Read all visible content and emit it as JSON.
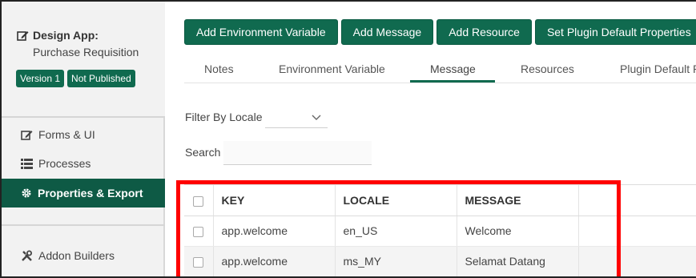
{
  "app": {
    "label": "Design App:",
    "name": "Purchase Requisition",
    "version_badge": "Version 1",
    "status_badge": "Not Published"
  },
  "sidebar": {
    "items": [
      {
        "label": "Forms & UI",
        "icon": "edit-icon"
      },
      {
        "label": "Processes",
        "icon": "list-icon"
      },
      {
        "label": "Properties & Export",
        "icon": "gear-icon",
        "active": true
      },
      {
        "label": "Addon Builders",
        "icon": "tools-icon"
      }
    ]
  },
  "toolbar": {
    "buttons": [
      "Add Environment Variable",
      "Add Message",
      "Add Resource",
      "Set Plugin Default Properties"
    ]
  },
  "tabs": [
    "Notes",
    "Environment Variable",
    "Message",
    "Resources",
    "Plugin Default P"
  ],
  "active_tab": "Message",
  "filter": {
    "label": "Filter By Locale",
    "value": ""
  },
  "search": {
    "label": "Search",
    "value": ""
  },
  "table": {
    "headers": [
      "KEY",
      "LOCALE",
      "MESSAGE"
    ],
    "rows": [
      {
        "key": "app.welcome",
        "locale": "en_US",
        "message": "Welcome"
      },
      {
        "key": "app.welcome",
        "locale": "ms_MY",
        "message": "Selamat Datang"
      }
    ]
  },
  "colors": {
    "accent": "#106a4f",
    "active_nav": "#0e5a45",
    "highlight": "#ff0000"
  }
}
